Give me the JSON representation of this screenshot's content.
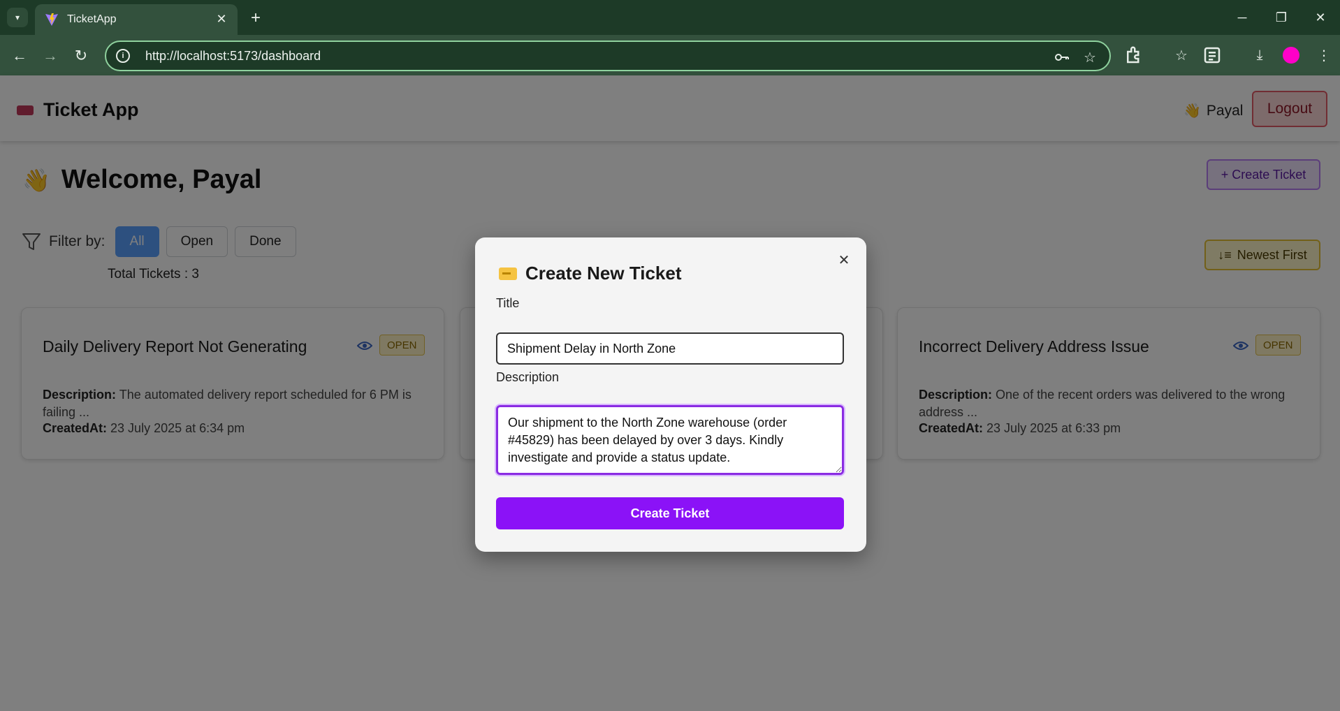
{
  "browser": {
    "tab_title": "TicketApp",
    "url": "http://localhost:5173/dashboard",
    "profile_color": "#ff00c8"
  },
  "header": {
    "brand": "Ticket App",
    "user_emoji": "👋",
    "user_name": "Payal",
    "logout_label": "Logout"
  },
  "main": {
    "welcome_emoji": "👋",
    "welcome": "Welcome, Payal",
    "create_button": "+ Create Ticket",
    "filter_label": "Filter by:",
    "filters": [
      "All",
      "Open",
      "Done"
    ],
    "active_filter": "All",
    "total_tickets": "Total Tickets : 3",
    "sort_label": "Newest First"
  },
  "tickets": [
    {
      "title": "Daily Delivery Report Not Generating",
      "status": "OPEN",
      "description_label": "Description:",
      "description": "The automated delivery report scheduled for 6 PM is failing ...",
      "created_label": "CreatedAt:",
      "created_at": "23 July 2025 at 6:34 pm"
    },
    {
      "title": "Incorrect Delivery Address Issue",
      "status": "OPEN",
      "description_label": "Description:",
      "description": "One of the recent orders was delivered to the wrong address ...",
      "created_label": "CreatedAt:",
      "created_at": "23 July 2025 at 6:33 pm"
    }
  ],
  "modal": {
    "title": "Create New Ticket",
    "title_field_label": "Title",
    "title_value": "Shipment Delay in North Zone",
    "description_field_label": "Description",
    "description_value": "Our shipment to the North Zone warehouse (order #45829) has been delayed by over 3 days. Kindly investigate and provide a status update.",
    "submit_label": "Create Ticket",
    "close_icon": "close-icon"
  },
  "colors": {
    "accent": "#8b12f7",
    "active_filter": "#5aa0ff",
    "logout": "#e35a66",
    "badge": "#fff3c4"
  }
}
